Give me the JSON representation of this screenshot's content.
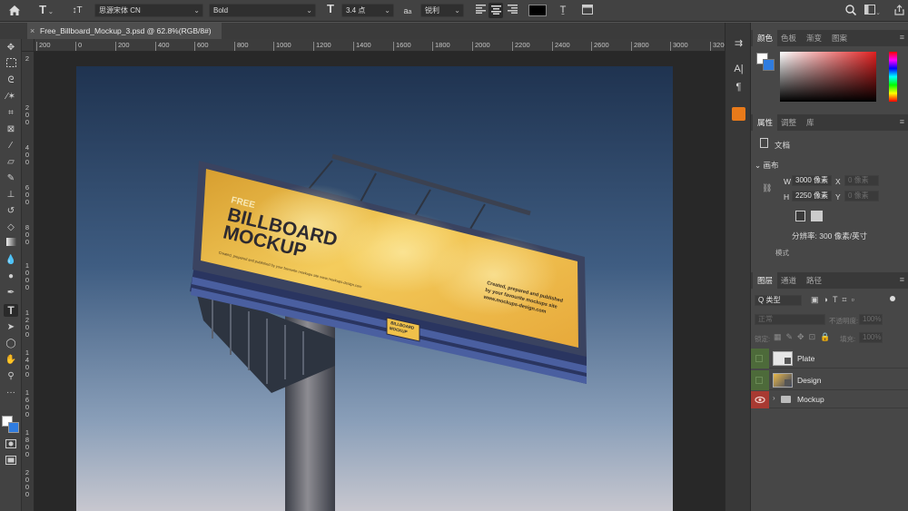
{
  "options_bar": {
    "font_family": "思源宋体 CN",
    "font_style": "Bold",
    "font_size": "3.4 点",
    "aa_label": "a",
    "anti_alias": "锐利",
    "text_color": "#000000"
  },
  "document_tab": {
    "title": "Free_Billboard_Mockup_3.psd @ 62.8%(RGB/8#)",
    "close": "×"
  },
  "ruler_top": {
    "ticks": [
      "200",
      "0",
      "200",
      "400",
      "600",
      "800",
      "1000",
      "1200",
      "1400",
      "1600",
      "1800",
      "2000",
      "2200",
      "2400",
      "2600",
      "2800",
      "3000",
      "3200"
    ]
  },
  "ruler_left": {
    "ticks": [
      "2",
      "200",
      "400",
      "600",
      "800",
      "1000",
      "1200",
      "1400",
      "1600",
      "1800",
      "2000"
    ]
  },
  "billboard": {
    "free": "FREE",
    "headline_1": "BILLBOARD",
    "headline_2": "MOCKUP",
    "tagline": "Created, prepared and published by your favourite mockups site www.mockups-design.com",
    "right_1": "Created, prepared and published",
    "right_2": "by your favourite mockups site",
    "right_3": "www.mockups-design.com",
    "plate_1": "BILLBOARD",
    "plate_2": "MOCKUP"
  },
  "color_panel": {
    "tabs": [
      "颜色",
      "色板",
      "渐变",
      "图案"
    ],
    "foreground": "#ffffff",
    "background": "#2f7ce0"
  },
  "properties_panel": {
    "tabs": [
      "属性",
      "调整",
      "库"
    ],
    "doc_label": "文档",
    "section": "画布",
    "w_label": "W",
    "w_value": "3000 像素",
    "h_label": "H",
    "h_value": "2250 像素",
    "x_label": "X",
    "x_value": "0 像素",
    "y_label": "Y",
    "y_value": "0 像素",
    "resolution": "分辨率: 300 像素/英寸",
    "mode": "模式"
  },
  "layers_panel": {
    "tabs": [
      "图层",
      "通道",
      "路径"
    ],
    "kind_filter": "Q 类型",
    "blend_mode": "正常",
    "opacity_label": "不透明度:",
    "opacity_value": "100%",
    "lock_label": "锁定:",
    "fill_label": "填充:",
    "fill_value": "100%",
    "layers": [
      {
        "name": "Plate",
        "visible": false
      },
      {
        "name": "Design",
        "visible": false
      },
      {
        "name": "Mockup",
        "visible": true,
        "group": true
      }
    ]
  }
}
